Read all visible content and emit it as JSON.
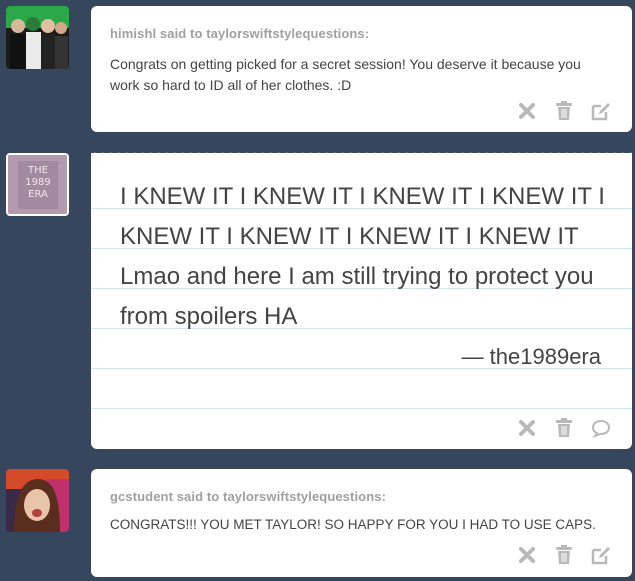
{
  "posts": [
    {
      "asker": "himishl said to taylorswiftstylequestions:",
      "message": "Congrats on getting picked for a secret session! You deserve it because you work so hard to ID all of her clothes. :D",
      "actions": [
        "delete",
        "trash",
        "edit"
      ]
    },
    {
      "note_text": "I KNEW IT I KNEW IT I KNEW IT I KNEW IT I KNEW IT I KNEW IT I KNEW IT I KNEW IT Lmao and here I am still trying to protect you from spoilers HA",
      "signature": "— the1989era",
      "avatar_text": "THE 1989 ERA",
      "actions": [
        "delete",
        "trash",
        "reply"
      ]
    },
    {
      "asker": "gcstudent said to taylorswiftstylequestions:",
      "message": "CONGRATS!!! YOU MET TAYLOR! SO HAPPY FOR YOU I HAD TO USE CAPS.",
      "actions": [
        "delete",
        "trash",
        "edit"
      ]
    }
  ],
  "colors": {
    "background": "#36465d",
    "card": "#ffffff",
    "asker_text": "#a0a0a0",
    "body_text": "#444444",
    "icon": "#b9b9b9",
    "rule_line": "#cfe3ea"
  },
  "icons": {
    "delete": "close-x-icon",
    "trash": "trash-icon",
    "edit": "edit-pencil-icon",
    "reply": "speech-bubble-icon"
  }
}
